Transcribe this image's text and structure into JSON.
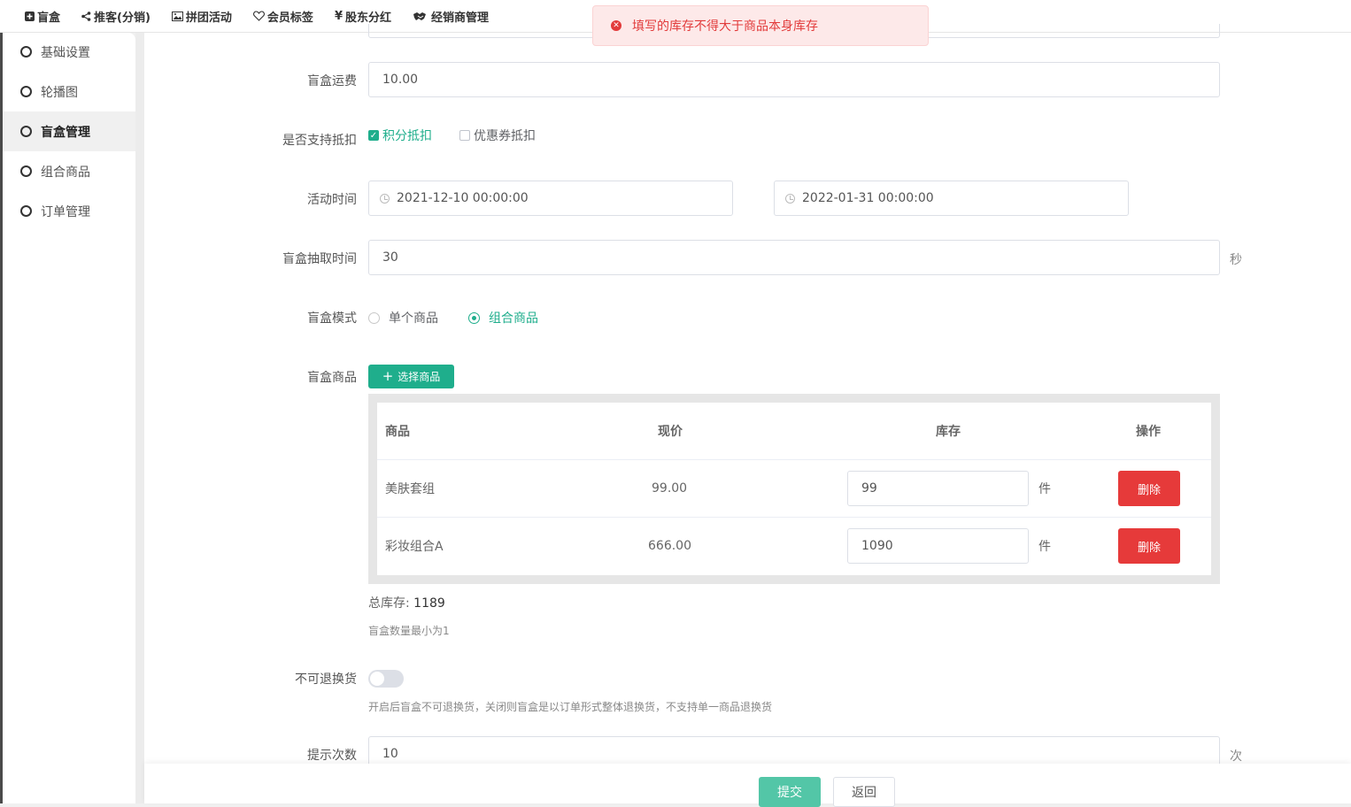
{
  "topnav": {
    "items": [
      {
        "icon": "plus-square-icon",
        "label": "盲盒"
      },
      {
        "icon": "share-icon",
        "label": "推客(分销)"
      },
      {
        "icon": "image-icon",
        "label": "拼团活动"
      },
      {
        "icon": "heart-icon",
        "label": "会员标签"
      },
      {
        "icon": "yen-icon",
        "label": "股东分红"
      },
      {
        "icon": "handshake-icon",
        "label": "经销商管理"
      }
    ]
  },
  "toast": {
    "icon": "error-circle-icon",
    "message": "填写的库存不得大于商品本身库存"
  },
  "sidebar": {
    "items": [
      {
        "label": "基础设置",
        "active": false
      },
      {
        "label": "轮播图",
        "active": false
      },
      {
        "label": "盲盒管理",
        "active": true
      },
      {
        "label": "组合商品",
        "active": false
      },
      {
        "label": "订单管理",
        "active": false
      }
    ]
  },
  "form": {
    "shipping": {
      "label": "盲盒运费",
      "value": "10.00"
    },
    "deduction": {
      "label": "是否支持抵扣",
      "points": {
        "label": "积分抵扣",
        "checked": true
      },
      "coupon": {
        "label": "优惠券抵扣",
        "checked": false
      }
    },
    "activity_time": {
      "label": "活动时间",
      "start": "2021-12-10 00:00:00",
      "end": "2022-01-31 00:00:00"
    },
    "draw_time": {
      "label": "盲盒抽取时间",
      "value": "30",
      "unit": "秒"
    },
    "mode": {
      "label": "盲盒模式",
      "options": [
        {
          "label": "单个商品",
          "selected": false
        },
        {
          "label": "组合商品",
          "selected": true
        }
      ]
    },
    "products": {
      "label": "盲盒商品",
      "select_button": "选择商品",
      "columns": {
        "product": "商品",
        "price": "现价",
        "stock": "库存",
        "action": "操作"
      },
      "rows": [
        {
          "name": "美肤套组",
          "price": "99.00",
          "stock": "99",
          "unit": "件",
          "delete": "删除"
        },
        {
          "name": "彩妆组合A",
          "price": "666.00",
          "stock": "1090",
          "unit": "件",
          "delete": "删除"
        }
      ],
      "total_label": "总库存:",
      "total_value": "1189",
      "min_hint": "盲盒数量最小为1"
    },
    "no_return": {
      "label": "不可退换货",
      "enabled": false,
      "hint": "开启后盲盒不可退换货，关闭则盲盒是以订单形式整体退换货，不支持单一商品退换货"
    },
    "prompt_count": {
      "label": "提示次数",
      "value": "10",
      "unit": "次"
    }
  },
  "footer": {
    "submit": "提交",
    "back": "返回"
  },
  "colors": {
    "accent": "#1fae8c",
    "danger": "#e63a3a",
    "toast_bg": "#fde9e9"
  }
}
